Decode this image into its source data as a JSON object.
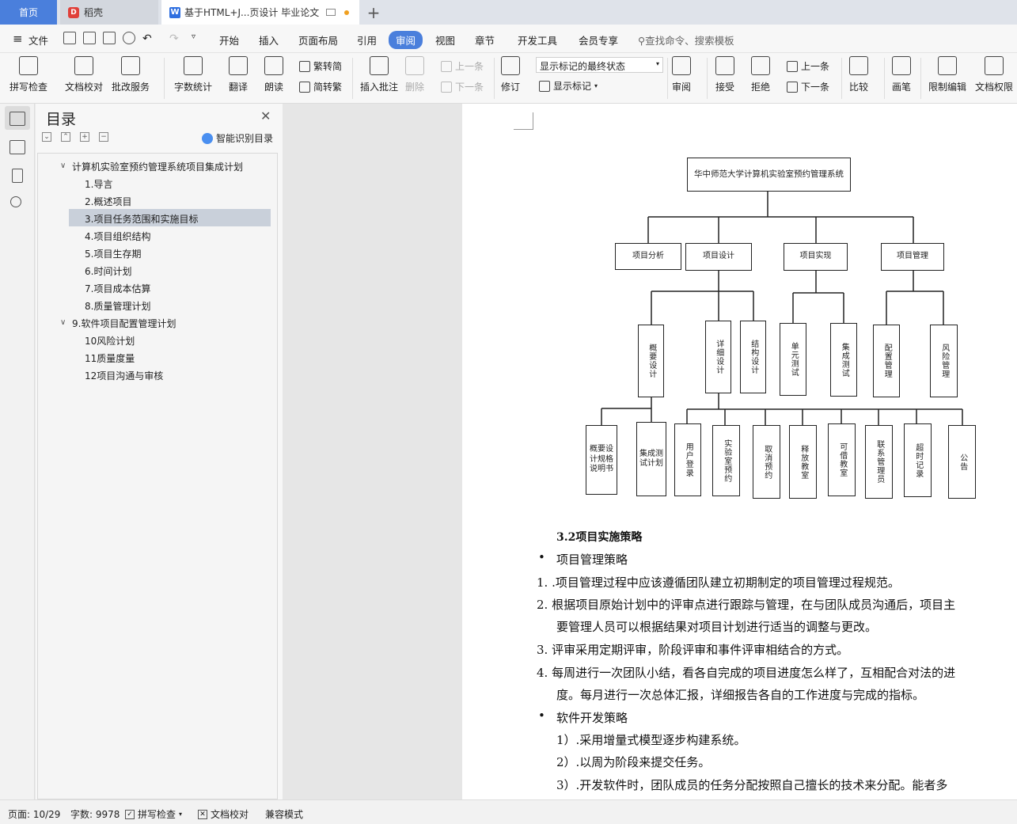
{
  "tabs": {
    "home": "首页",
    "daoke": "稻壳",
    "doc": "基于HTML+J...页设计 毕业论文",
    "daoke_logo": "D",
    "doc_logo": "W"
  },
  "menu": {
    "file": "文件",
    "items": [
      "开始",
      "插入",
      "页面布局",
      "引用",
      "审阅",
      "视图",
      "章节",
      "开发工具",
      "会员专享"
    ],
    "active": "审阅",
    "search": "查找命令、搜索模板"
  },
  "ribbon": {
    "spell": "拼写检查",
    "proof": "文档校对",
    "batch": "批改服务",
    "wordcount": "字数统计",
    "translate": "翻译",
    "read": "朗读",
    "trad": "繁转简",
    "simp": "简转繁",
    "insert_comment": "插入批注",
    "delete": "删除",
    "prev": "上一条",
    "next": "下一条",
    "track": "修订",
    "show_state": "显示标记的最终状态",
    "show_marks": "显示标记",
    "review": "审阅",
    "accept": "接受",
    "reject": "拒绝",
    "prev2": "上一条",
    "next2": "下一条",
    "compare": "比较",
    "pen": "画笔",
    "restrict": "限制编辑",
    "perm": "文档权限"
  },
  "toc": {
    "title": "目录",
    "smart": "智能识别目录",
    "items": [
      "计算机实验室预约管理系统项目集成计划",
      "1.导言",
      "2.概述项目",
      "3.项目任务范围和实施目标",
      "4.项目组织结构",
      "5.项目生存期",
      "6.时间计划",
      "7.项目成本估算",
      "8.质量管理计划",
      "9.软件项目配置管理计划",
      "10风险计划",
      "11质量度量",
      "12项目沟通与审核"
    ],
    "selected": "3.项目任务范围和实施目标"
  },
  "diagram": {
    "root": "华中师范大学计算机实验室预约管理系统",
    "l1": [
      "项目分析",
      "项目设计",
      "项目实现",
      "项目管理"
    ],
    "l2": [
      "概要设计",
      "详细设计",
      "结构设计",
      "单元测试",
      "集成测试",
      "配置管理",
      "风险管理"
    ],
    "l3": [
      "概要设计规格说明书",
      "集成测试计划",
      "用户登录",
      "实验室预约",
      "取消预约",
      "释放教室",
      "可借教室",
      "联系管理员",
      "超时记录",
      "公告"
    ]
  },
  "doc": {
    "heading": "3.2项目实施策略",
    "b1": "项目管理策略",
    "p1": "1.  .项目管理过程中应该遵循团队建立初期制定的项目管理过程规范。",
    "p2a": "2.  根据项目原始计划中的评审点进行跟踪与管理，在与团队成员沟通后，项目主",
    "p2b": "要管理人员可以根据结果对项目计划进行适当的调整与更改。",
    "p3": "3.  评审采用定期评审，阶段评审和事件评审相结合的方式。",
    "p4a": "4.  每周进行一次团队小结，看各自完成的项目进度怎么样了，互相配合对法的进",
    "p4b": "度。每月进行一次总体汇报，详细报告各自的工作进度与完成的指标。",
    "b2": "软件开发策略",
    "s1": "1）.采用增量式模型逐步构建系统。",
    "s2": "2）.以周为阶段来提交任务。",
    "s3": "3）.开发软件时，团队成员的任务分配按照自己擅长的技术来分配。能者多"
  },
  "status": {
    "page": "页面: 10/29",
    "words": "字数: 9978",
    "spell": "拼写检查",
    "proof": "文档校对",
    "compat": "兼容模式"
  }
}
